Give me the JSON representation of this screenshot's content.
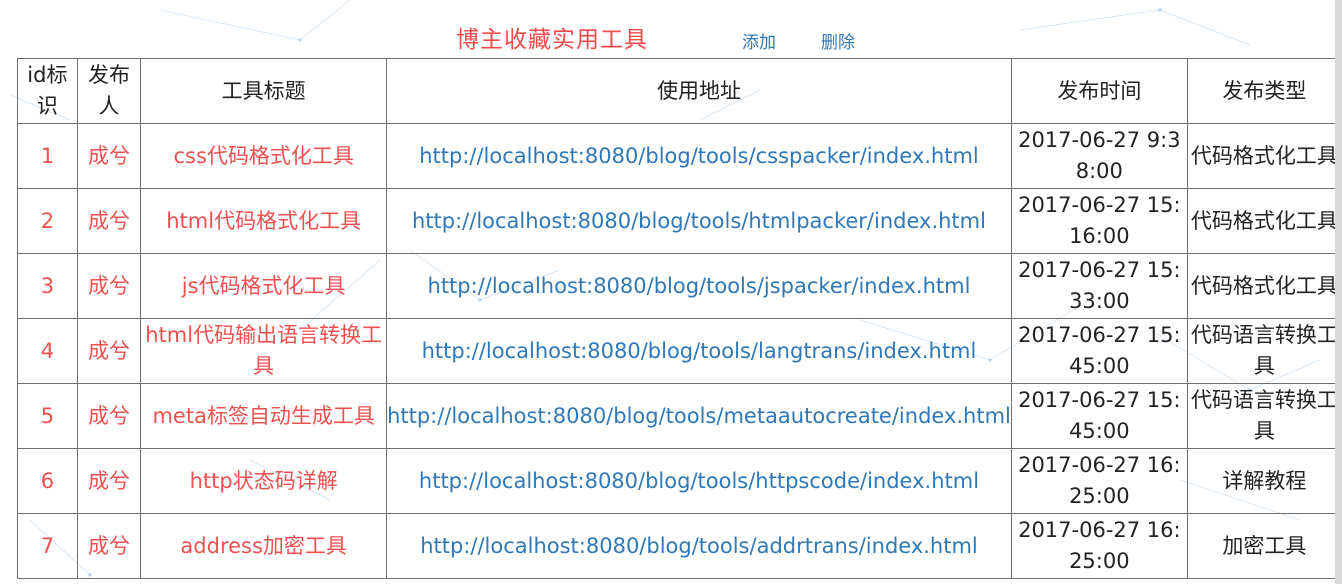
{
  "header": {
    "title": "博主收藏实用工具",
    "add_label": "添加",
    "delete_label": "删除"
  },
  "table": {
    "columns": [
      "id标识",
      "发布人",
      "工具标题",
      "使用地址",
      "发布时间",
      "发布类型"
    ],
    "rows": [
      {
        "id": "1",
        "author": "成兮",
        "title": "css代码格式化工具",
        "url": "http://localhost:8080/blog/tools/csspacker/index.html",
        "time": "2017-06-27 9:38:00",
        "type": "代码格式化工具"
      },
      {
        "id": "2",
        "author": "成兮",
        "title": "html代码格式化工具",
        "url": "http://localhost:8080/blog/tools/htmlpacker/index.html",
        "time": "2017-06-27 15:16:00",
        "type": "代码格式化工具"
      },
      {
        "id": "3",
        "author": "成兮",
        "title": "js代码格式化工具",
        "url": "http://localhost:8080/blog/tools/jspacker/index.html",
        "time": "2017-06-27 15:33:00",
        "type": "代码格式化工具"
      },
      {
        "id": "4",
        "author": "成兮",
        "title": "html代码输出语言转换工具",
        "url": "http://localhost:8080/blog/tools/langtrans/index.html",
        "time": "2017-06-27 15:45:00",
        "type": "代码语言转换工具"
      },
      {
        "id": "5",
        "author": "成兮",
        "title": "meta标签自动生成工具",
        "url": "http://localhost:8080/blog/tools/metaautocreate/index.html",
        "time": "2017-06-27 15:45:00",
        "type": "代码语言转换工具"
      },
      {
        "id": "6",
        "author": "成兮",
        "title": "http状态码详解",
        "url": "http://localhost:8080/blog/tools/httpscode/index.html",
        "time": "2017-06-27 16:25:00",
        "type": "详解教程"
      },
      {
        "id": "7",
        "author": "成兮",
        "title": "address加密工具",
        "url": "http://localhost:8080/blog/tools/addrtrans/index.html",
        "time": "2017-06-27 16:25:00",
        "type": "加密工具"
      }
    ]
  },
  "colors": {
    "title": "#ef4b4b",
    "link": "#2f78b7",
    "red_text": "#ef5050",
    "border": "#6f6f6f"
  }
}
